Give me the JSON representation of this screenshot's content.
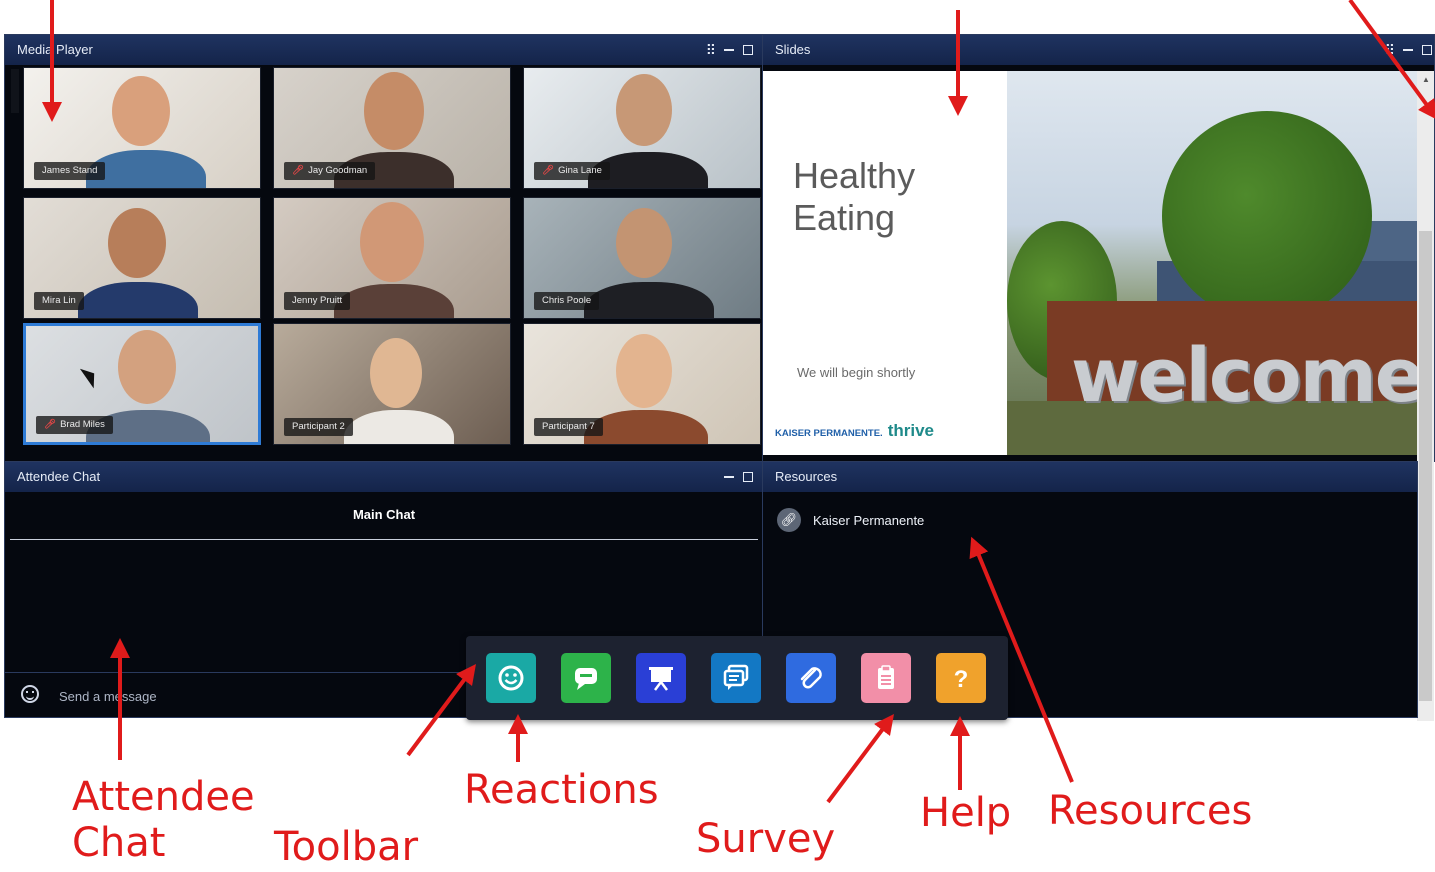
{
  "media_player": {
    "title": "Media Player",
    "participants": [
      {
        "name": "James Stand",
        "muted": false
      },
      {
        "name": "Jay Goodman",
        "muted": true
      },
      {
        "name": "Gina Lane",
        "muted": true
      },
      {
        "name": "Mira Lin",
        "muted": false
      },
      {
        "name": "Jenny Pruitt",
        "muted": false
      },
      {
        "name": "Chris Poole",
        "muted": false
      },
      {
        "name": "Brad Miles",
        "muted": true
      },
      {
        "name": "Participant 2",
        "muted": false
      },
      {
        "name": "Participant 7",
        "muted": false
      }
    ]
  },
  "slides": {
    "title": "Slides",
    "heading": "Healthy Eating",
    "subtitle": "We will begin shortly",
    "logo_text": "KAISER PERMANENTE.",
    "logo_brand": "thrive",
    "photo_text": "welcome"
  },
  "chat": {
    "title": "Attendee Chat",
    "tab": "Main Chat",
    "placeholder": "Send a message"
  },
  "resources": {
    "title": "Resources",
    "items": [
      {
        "label": "Kaiser Permanente",
        "icon": "link-icon"
      }
    ]
  },
  "toolbar": {
    "buttons": [
      {
        "name": "reactions",
        "icon": "smiley-icon",
        "color": "#1aa9a5"
      },
      {
        "name": "chat",
        "icon": "chat-bubble-icon",
        "color": "#2db34a"
      },
      {
        "name": "slides",
        "icon": "presentation-icon",
        "color": "#2a3fd6"
      },
      {
        "name": "qa",
        "icon": "messages-icon",
        "color": "#1378c4"
      },
      {
        "name": "resources",
        "icon": "paperclip-icon",
        "color": "#2f6be0"
      },
      {
        "name": "survey",
        "icon": "clipboard-icon",
        "color": "#f28fa8"
      },
      {
        "name": "help",
        "icon": "question-icon",
        "color": "#f0a22c"
      }
    ]
  },
  "annotations": {
    "attendee_chat": "Attendee\nChat",
    "toolbar": "Toolbar",
    "reactions": "Reactions",
    "survey": "Survey",
    "help": "Help",
    "resources": "Resources",
    "color": "#e01b1b"
  }
}
